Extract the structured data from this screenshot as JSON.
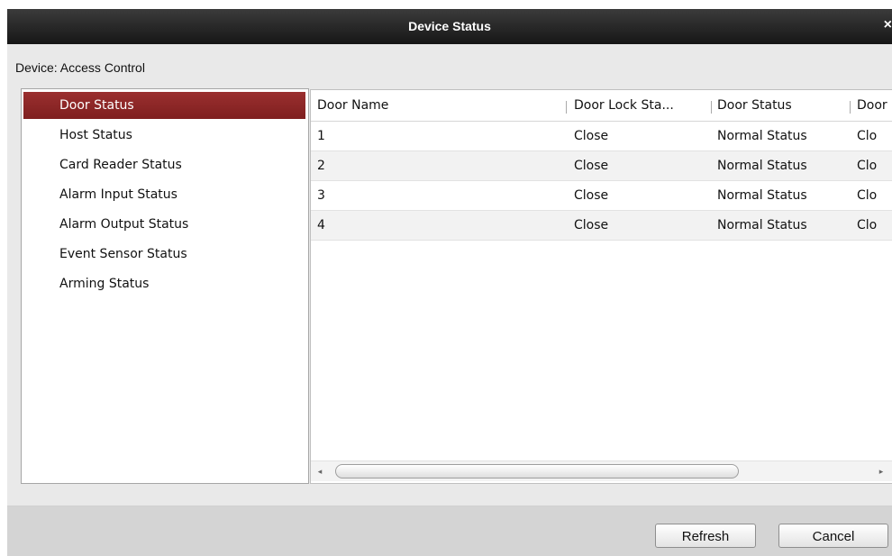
{
  "dialog": {
    "title": "Device Status",
    "close_glyph": "×",
    "device_label": "Device: Access Control"
  },
  "sidebar": {
    "items": [
      {
        "label": "Door Status",
        "selected": true
      },
      {
        "label": "Host Status",
        "selected": false
      },
      {
        "label": "Card Reader Status",
        "selected": false
      },
      {
        "label": "Alarm Input Status",
        "selected": false
      },
      {
        "label": "Alarm Output Status",
        "selected": false
      },
      {
        "label": "Event Sensor Status",
        "selected": false
      },
      {
        "label": "Arming Status",
        "selected": false
      }
    ]
  },
  "table": {
    "columns": [
      "Door Name",
      "Door Lock Sta...",
      "Door Status",
      "Door"
    ],
    "rows": [
      [
        "1",
        "Close",
        "Normal Status",
        "Clo"
      ],
      [
        "2",
        "Close",
        "Normal Status",
        "Clo"
      ],
      [
        "3",
        "Close",
        "Normal Status",
        "Clo"
      ],
      [
        "4",
        "Close",
        "Normal Status",
        "Clo"
      ]
    ]
  },
  "scrollbar": {
    "left_arrow": "◂",
    "right_arrow": "▸"
  },
  "buttons": {
    "refresh": "Refresh",
    "cancel": "Cancel"
  },
  "colors": {
    "selected_bg": "#8b2525",
    "title_bg": "#1f1f1f"
  }
}
